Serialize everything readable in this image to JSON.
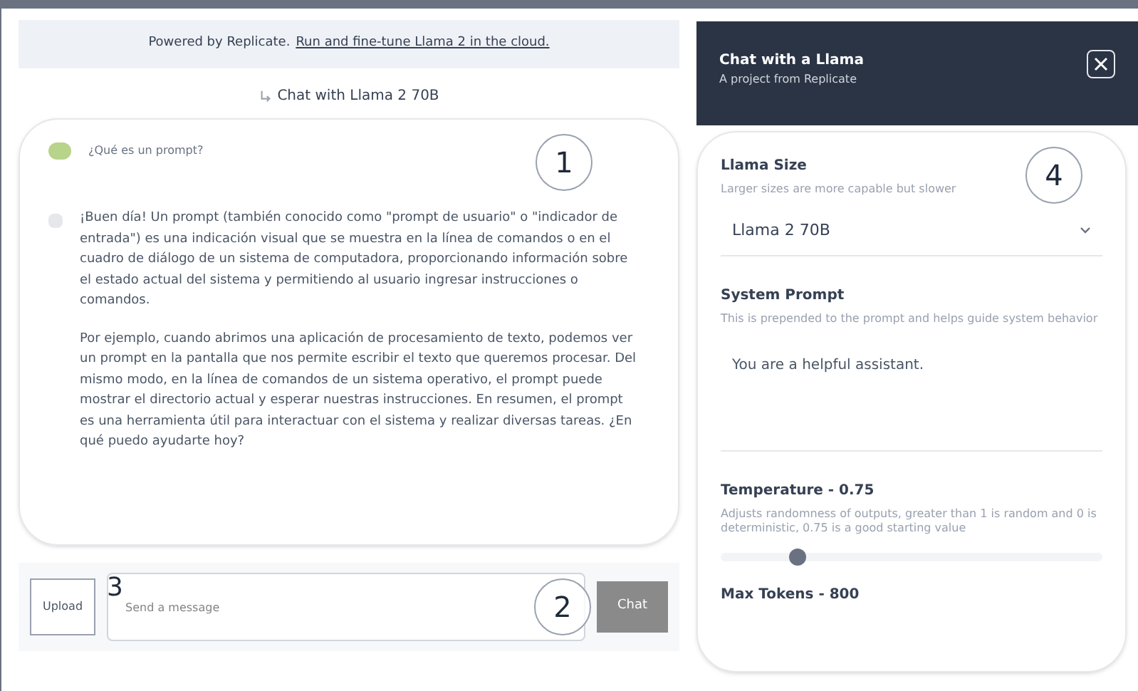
{
  "banner": {
    "text": "Powered by Replicate.",
    "link": "Run and fine-tune Llama 2 in the cloud."
  },
  "chat_title": "Chat with Llama 2 70B",
  "messages": [
    {
      "kind": "user",
      "paragraphs": [
        "¿Qué es un prompt?"
      ]
    },
    {
      "kind": "assistant",
      "paragraphs": [
        "¡Buen día! Un prompt (también conocido como \"prompt de usuario\" o \"indicador de entrada\") es una indicación visual que se muestra en la línea de comandos o en el cuadro de diálogo de un sistema de computadora, proporcionando información sobre el estado actual del sistema y permitiendo al usuario ingresar instrucciones o comandos.",
        "Por ejemplo, cuando abrimos una aplicación de procesamiento de texto, podemos ver un prompt en la pantalla que nos permite escribir el texto que queremos procesar. Del mismo modo, en la línea de comandos de un sistema operativo, el prompt puede mostrar el directorio actual y esperar nuestras instrucciones. En resumen, el prompt es una herramienta útil para interactuar con el sistema y realizar diversas tareas. ¿En qué puedo ayudarte hoy?"
      ]
    }
  ],
  "composer": {
    "upload": "Upload",
    "placeholder": "Send a message",
    "send": "Chat"
  },
  "sidebar": {
    "title": "Chat with a Llama",
    "subtitle": "A project from Replicate",
    "settings": [
      {
        "kind": "select",
        "label": "Llama Size",
        "hint": "Larger sizes are more capable but slower",
        "value": "Llama 2 70B"
      },
      {
        "kind": "textarea",
        "label": "System Prompt",
        "hint": "This is prepended to the prompt and helps guide system behavior",
        "value": "You are a helpful assistant."
      },
      {
        "kind": "slider",
        "label": "Temperature - 0.75",
        "hint": "Adjusts randomness of outputs, greater than 1 is random and 0 is deterministic, 0.75 is a good starting value",
        "level": 0.2
      },
      {
        "kind": "heading",
        "label": "Max Tokens - 800"
      }
    ]
  },
  "annotations": [
    "1",
    "2",
    "3",
    "4"
  ]
}
